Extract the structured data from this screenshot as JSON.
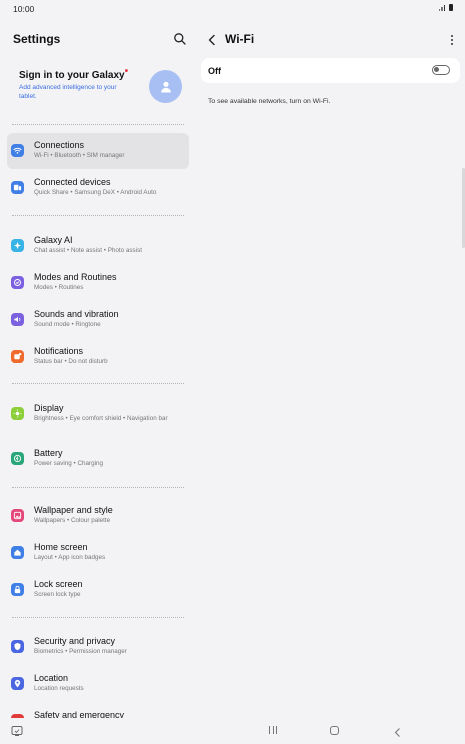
{
  "status": {
    "time": "10:00"
  },
  "settings": {
    "title": "Settings",
    "account": {
      "title": "Sign in to your Galaxy",
      "subtitle": "Add advanced intelligence to your tablet."
    },
    "items": [
      {
        "label": "Connections",
        "sub": "Wi-Fi  •  Bluetooth  •  SIM manager",
        "color": "#3f7fe6",
        "icon": "wifi-icon"
      },
      {
        "label": "Connected devices",
        "sub": "Quick Share  •  Samsung DeX  •  Android Auto",
        "color": "#3f7fe6",
        "icon": "devices-icon"
      },
      {
        "label": "Galaxy AI",
        "sub": "Chat assist  •  Note assist  •  Photo assist",
        "color": "#38b3e6",
        "icon": "galaxy-ai-icon"
      },
      {
        "label": "Modes and Routines",
        "sub": "Modes  •  Routines",
        "color": "#7b61e0",
        "icon": "modes-icon"
      },
      {
        "label": "Sounds and vibration",
        "sub": "Sound mode  •  Ringtone",
        "color": "#7b61e0",
        "icon": "sound-icon"
      },
      {
        "label": "Notifications",
        "sub": "Status bar  •  Do not disturb",
        "color": "#ef6a2c",
        "icon": "notifications-icon"
      },
      {
        "label": "Display",
        "sub": "Brightness  •  Eye comfort shield  •  Navigation bar",
        "color": "#8ccf3b",
        "icon": "display-icon"
      },
      {
        "label": "Battery",
        "sub": "Power saving  •  Charging",
        "color": "#28a67a",
        "icon": "battery-icon"
      },
      {
        "label": "Wallpaper and style",
        "sub": "Wallpapers  •  Colour palette",
        "color": "#e4487a",
        "icon": "wallpaper-icon"
      },
      {
        "label": "Home screen",
        "sub": "Layout  •  App icon badges",
        "color": "#3f7fe6",
        "icon": "home-screen-icon"
      },
      {
        "label": "Lock screen",
        "sub": "Screen lock type",
        "color": "#3f7fe6",
        "icon": "lock-icon"
      },
      {
        "label": "Security and privacy",
        "sub": "Biometrics  •  Permission manager",
        "color": "#4a66e0",
        "icon": "security-icon"
      },
      {
        "label": "Location",
        "sub": "Location requests",
        "color": "#4a66e0",
        "icon": "location-icon"
      },
      {
        "label": "Safety and emergency",
        "sub": "",
        "color": "#e03a3a",
        "icon": "emergency-icon"
      }
    ]
  },
  "wifi": {
    "title": "Wi-Fi",
    "state_label": "Off",
    "enabled": false,
    "hint": "To see available networks, turn on Wi-Fi."
  }
}
